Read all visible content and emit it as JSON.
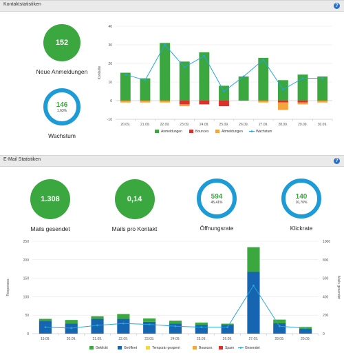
{
  "contact_section": {
    "title": "Kontaktstatistiken",
    "help": "?",
    "new_signups": {
      "value": "152",
      "label": "Neue Anmeldungen"
    },
    "growth": {
      "value": "146",
      "sub": "1,63%",
      "label": "Wachstum"
    }
  },
  "email_section": {
    "title": "E-Mail Statistiken",
    "help": "?",
    "mails_sent": {
      "value": "1.308",
      "label": "Mails gesendet"
    },
    "mails_per_contact": {
      "value": "0,14",
      "label": "Mails pro Kontakt"
    },
    "open_rate": {
      "value": "594",
      "sub": "45,41%",
      "label": "Öffnungsrate"
    },
    "click_rate": {
      "value": "140",
      "sub": "10,70%",
      "label": "Klickrate"
    }
  },
  "colors": {
    "green": "#3aa83f",
    "blue": "#1d9bd6",
    "red": "#d9312b",
    "orange": "#f4a53b",
    "darkblue": "#1565b0",
    "yellow": "#f5d84a",
    "line": "#27a6d8"
  },
  "chart_data": [
    {
      "type": "bar",
      "ylabel": "Kontakte",
      "ylim": [
        -10,
        40
      ],
      "yticks": [
        "40",
        "30",
        "20",
        "10",
        "0",
        "-10"
      ],
      "categories": [
        "20.09.",
        "21.09.",
        "22.09.",
        "23.09.",
        "24.09.",
        "25.09.",
        "26.09.",
        "27.09.",
        "28.09.",
        "29.09.",
        "30.09."
      ],
      "series": [
        {
          "name": "Anmeldungen",
          "values": [
            15,
            12,
            31,
            21,
            26,
            8,
            13,
            23,
            11,
            14,
            13
          ]
        },
        {
          "name": "Bounces",
          "values": [
            0,
            0,
            0,
            -2,
            -2,
            -3,
            0,
            0,
            -1,
            -1,
            0
          ]
        },
        {
          "name": "Abmeldungen",
          "values": [
            -1,
            -1,
            -1,
            -1,
            0,
            0,
            0,
            -1,
            -4,
            -1,
            -1
          ]
        },
        {
          "name": "Wachstum",
          "values": [
            14,
            11,
            30,
            18,
            24,
            5,
            13,
            22,
            6,
            12,
            12
          ]
        }
      ],
      "legend": "bottom"
    },
    {
      "type": "bar",
      "ylabel": "Responses",
      "y2label": "Mails gesendet",
      "ylim": [
        0,
        250
      ],
      "y2lim": [
        0,
        1000
      ],
      "yticks": [
        "250",
        "200",
        "150",
        "100",
        "50",
        "0"
      ],
      "y2ticks": [
        "1000",
        "800",
        "600",
        "400",
        "200",
        "0"
      ],
      "categories": [
        "19.09.",
        "20.09.",
        "21.09.",
        "22.09.",
        "23.09.",
        "24.09.",
        "25.09.",
        "26.09.",
        "27.09.",
        "28.09.",
        "29.09."
      ],
      "series": [
        {
          "name": "Geklickt",
          "values": [
            5,
            10,
            7,
            13,
            9,
            8,
            6,
            3,
            67,
            10,
            5
          ]
        },
        {
          "name": "Geöffnet",
          "values": [
            35,
            27,
            40,
            40,
            32,
            27,
            24,
            24,
            167,
            28,
            13
          ]
        },
        {
          "name": "Temporär gesperrt",
          "values": [
            0,
            0,
            0,
            0,
            0,
            0,
            0,
            0,
            0,
            0,
            0
          ]
        },
        {
          "name": "Bounces",
          "values": [
            0,
            0,
            0,
            0,
            0,
            0,
            0,
            0,
            0,
            0,
            0
          ]
        },
        {
          "name": "Spam",
          "values": [
            0,
            0,
            0,
            0,
            0,
            0,
            0,
            0,
            0,
            0,
            0
          ]
        },
        {
          "name": "Gesendet",
          "axis": "right",
          "values": [
            70,
            60,
            90,
            110,
            100,
            80,
            70,
            70,
            520,
            80,
            60
          ]
        }
      ],
      "legend": "bottom"
    }
  ]
}
